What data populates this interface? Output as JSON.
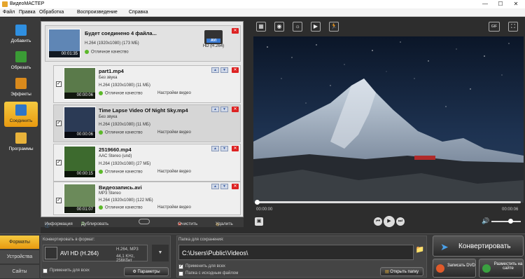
{
  "window": {
    "title": "ВидеоМАСТЕР",
    "minimize": "—",
    "maximize": "☐",
    "close": "✕"
  },
  "menu": [
    "Файл",
    "Правка",
    "Обработка",
    "Воспроизведение",
    "Справка"
  ],
  "sidebar": [
    {
      "label": "Добавить",
      "icon": "add-file-icon",
      "color": "#2f8fe0"
    },
    {
      "label": "Обрезать",
      "icon": "trim-icon",
      "color": "#3a9b35"
    },
    {
      "label": "Эффекты",
      "icon": "effects-icon",
      "color": "#d98a1c"
    },
    {
      "label": "Соединить",
      "icon": "join-icon",
      "color": "#2e75c7"
    },
    {
      "label": "Программы",
      "icon": "programs-icon",
      "color": "#e8b23a"
    }
  ],
  "main_item": {
    "title": "Будет соединено 4 файла...",
    "codec": "H.264 (1920x1080) (173 МБ)",
    "quality": "Отличное качество",
    "duration": "00:01:35",
    "format": "AVI",
    "format_label": "HD (H.264)"
  },
  "items": [
    {
      "name": "part1.mp4",
      "audio": "Без звука",
      "codec": "H.264 (1920x1080) (11 МБ)",
      "quality": "Отличное качество",
      "settings": "Настройки видео",
      "duration": "00:00:06",
      "checked": "✓",
      "thumb": "#5a7a4a"
    },
    {
      "name": "Time Lapse Video Of Night Sky.mp4",
      "audio": "Без звука",
      "codec": "H.264 (1920x1080) (11 МБ)",
      "quality": "Отличное качество",
      "settings": "Настройки видео",
      "duration": "00:00:06",
      "checked": "✓",
      "thumb": "#2b3a55"
    },
    {
      "name": "2519660.mp4",
      "audio": "AAC Stereo (und)",
      "codec": "H.264 (1920x1080) (27 МБ)",
      "quality": "Отличное качество",
      "settings": "Настройки видео",
      "duration": "00:00:15",
      "checked": "✓",
      "thumb": "#3d6a2e"
    },
    {
      "name": "Видеозапись.avi",
      "audio": "MP3 Stereo",
      "codec": "H.264 (1920x1080) (122 МБ)",
      "quality": "Отличное качество",
      "settings": "Настройки видео",
      "duration": "00:01:07",
      "checked": "✓",
      "thumb": "#6b8a5a"
    }
  ],
  "list_toolbar": {
    "info": "Информация",
    "duplicate": "Дублировать",
    "clear": "Очистить",
    "delete": "Удалить"
  },
  "player": {
    "time_start": "00:00:00",
    "time_end": "00:00:06",
    "progress": 0.0,
    "volume": 0.6
  },
  "video_tools": [
    "crop-icon",
    "rotate-icon",
    "brightness-icon",
    "speed-icon",
    "slow-motion-icon"
  ],
  "gif_label": "GIF",
  "bottom_tabs": [
    "Форматы",
    "Устройства",
    "Сайты"
  ],
  "convert": {
    "label": "Конвертировать в формат:",
    "format": "AVI HD (H.264)",
    "codec": "H.264, MP3",
    "audio": "44,1 KHz, 256Кбит",
    "apply_all": "Применить для всех",
    "params": "Параметры"
  },
  "save": {
    "label": "Папка для сохранения:",
    "path": "C:\\Users\\Public\\Videos\\",
    "apply_all": "Применить для всех",
    "same_folder": "Папка с исходным файлом",
    "open_folder": "Открыть папку"
  },
  "actions": {
    "convert": "Конвертировать",
    "burn": "Записать DVD",
    "publish": "Разместить на сайте"
  }
}
